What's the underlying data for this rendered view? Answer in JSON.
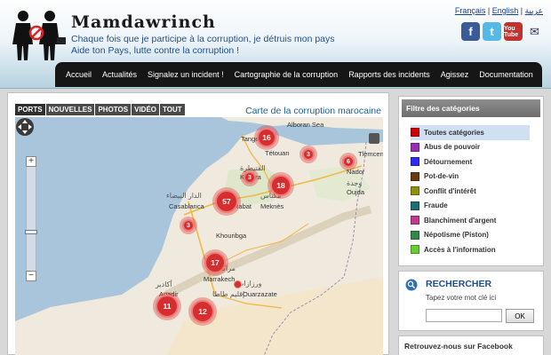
{
  "site": {
    "name": "Mamdawrinch",
    "tagline_1": "Chaque fois que je participe à la corruption, je détruis mon pays",
    "tagline_2": "Aide ton Pays, lutte contre la corruption !"
  },
  "languages": {
    "fr": "Français",
    "sep1": " | ",
    "en": "English",
    "sep2": " | ",
    "ar": "عربية"
  },
  "social": {
    "facebook": "f",
    "twitter": "t",
    "youtube": "You Tube",
    "rss": "✉"
  },
  "nav": {
    "items": [
      "Accueil",
      "Actualités",
      "Signalez un incident !",
      "Cartographie de la corruption",
      "Rapports des incidents",
      "Agissez",
      "Documentation"
    ]
  },
  "map_panel": {
    "tabs": [
      "PORTS",
      "NOUVELLES",
      "PHOTOS",
      "VIDÉO",
      "TOUT"
    ],
    "title": "Carte de la corruption marocaine",
    "markers": [
      {
        "count": "16"
      },
      {
        "count": "3"
      },
      {
        "count": "6"
      },
      {
        "count": "3"
      },
      {
        "count": "18"
      },
      {
        "count": "57"
      },
      {
        "count": "3"
      },
      {
        "count": "17"
      },
      {
        "count": "11"
      },
      {
        "count": "12"
      },
      {
        "count": ""
      }
    ],
    "cities": {
      "alboran": "Alboran Sea",
      "tanger": "Tanger",
      "tetouan": "Tétouan",
      "tlemcen": "Tlemcen",
      "kenitra_ar": "القنيطرة",
      "kenitra": "Kénitra",
      "casablanca_ar": "الدار البيضاء",
      "casablanca": "Casablanca",
      "rabat": "Rabat",
      "meknes_ar": "مكناس",
      "meknes": "Meknès",
      "nador": "Nador",
      "oujda_ar": "وجدة",
      "oujda": "Oujda",
      "khouribga": "Khouribga",
      "marrakech_ar": "مراكش",
      "marrakech": "Marrakech",
      "agadir_ar": "أكادير",
      "agadir": "Agadir",
      "ouarzazate_ar": "ورزازات",
      "ouarzazate": "Ouarzazate",
      "guelmim": "إقليم طاطا"
    },
    "pan_label": "✥",
    "zoom_in": "+",
    "zoom_out": "−"
  },
  "categories": {
    "header": "Filtre des catégories",
    "items": [
      {
        "label": "Toutes catégories",
        "color": "#cc0000"
      },
      {
        "label": "Abus de pouvoir",
        "color": "#9b2db5"
      },
      {
        "label": "Détournement",
        "color": "#2d2df0"
      },
      {
        "label": "Pot-de-vin",
        "color": "#6b3a10"
      },
      {
        "label": "Conflit d'intérêt",
        "color": "#8e8e10"
      },
      {
        "label": "Fraude",
        "color": "#1d6e6e"
      },
      {
        "label": "Blanchiment d'argent",
        "color": "#c03a8a"
      },
      {
        "label": "Népotisme (Piston)",
        "color": "#2f8a4a"
      },
      {
        "label": "Accès à l'information",
        "color": "#66cc33"
      }
    ]
  },
  "search": {
    "title": "RECHERCHER",
    "hint": "Tapez votre mot clé ici",
    "input_value": "",
    "button": "OK"
  },
  "facebook_panel": {
    "title": "Retrouvez-nous sur Facebook"
  }
}
